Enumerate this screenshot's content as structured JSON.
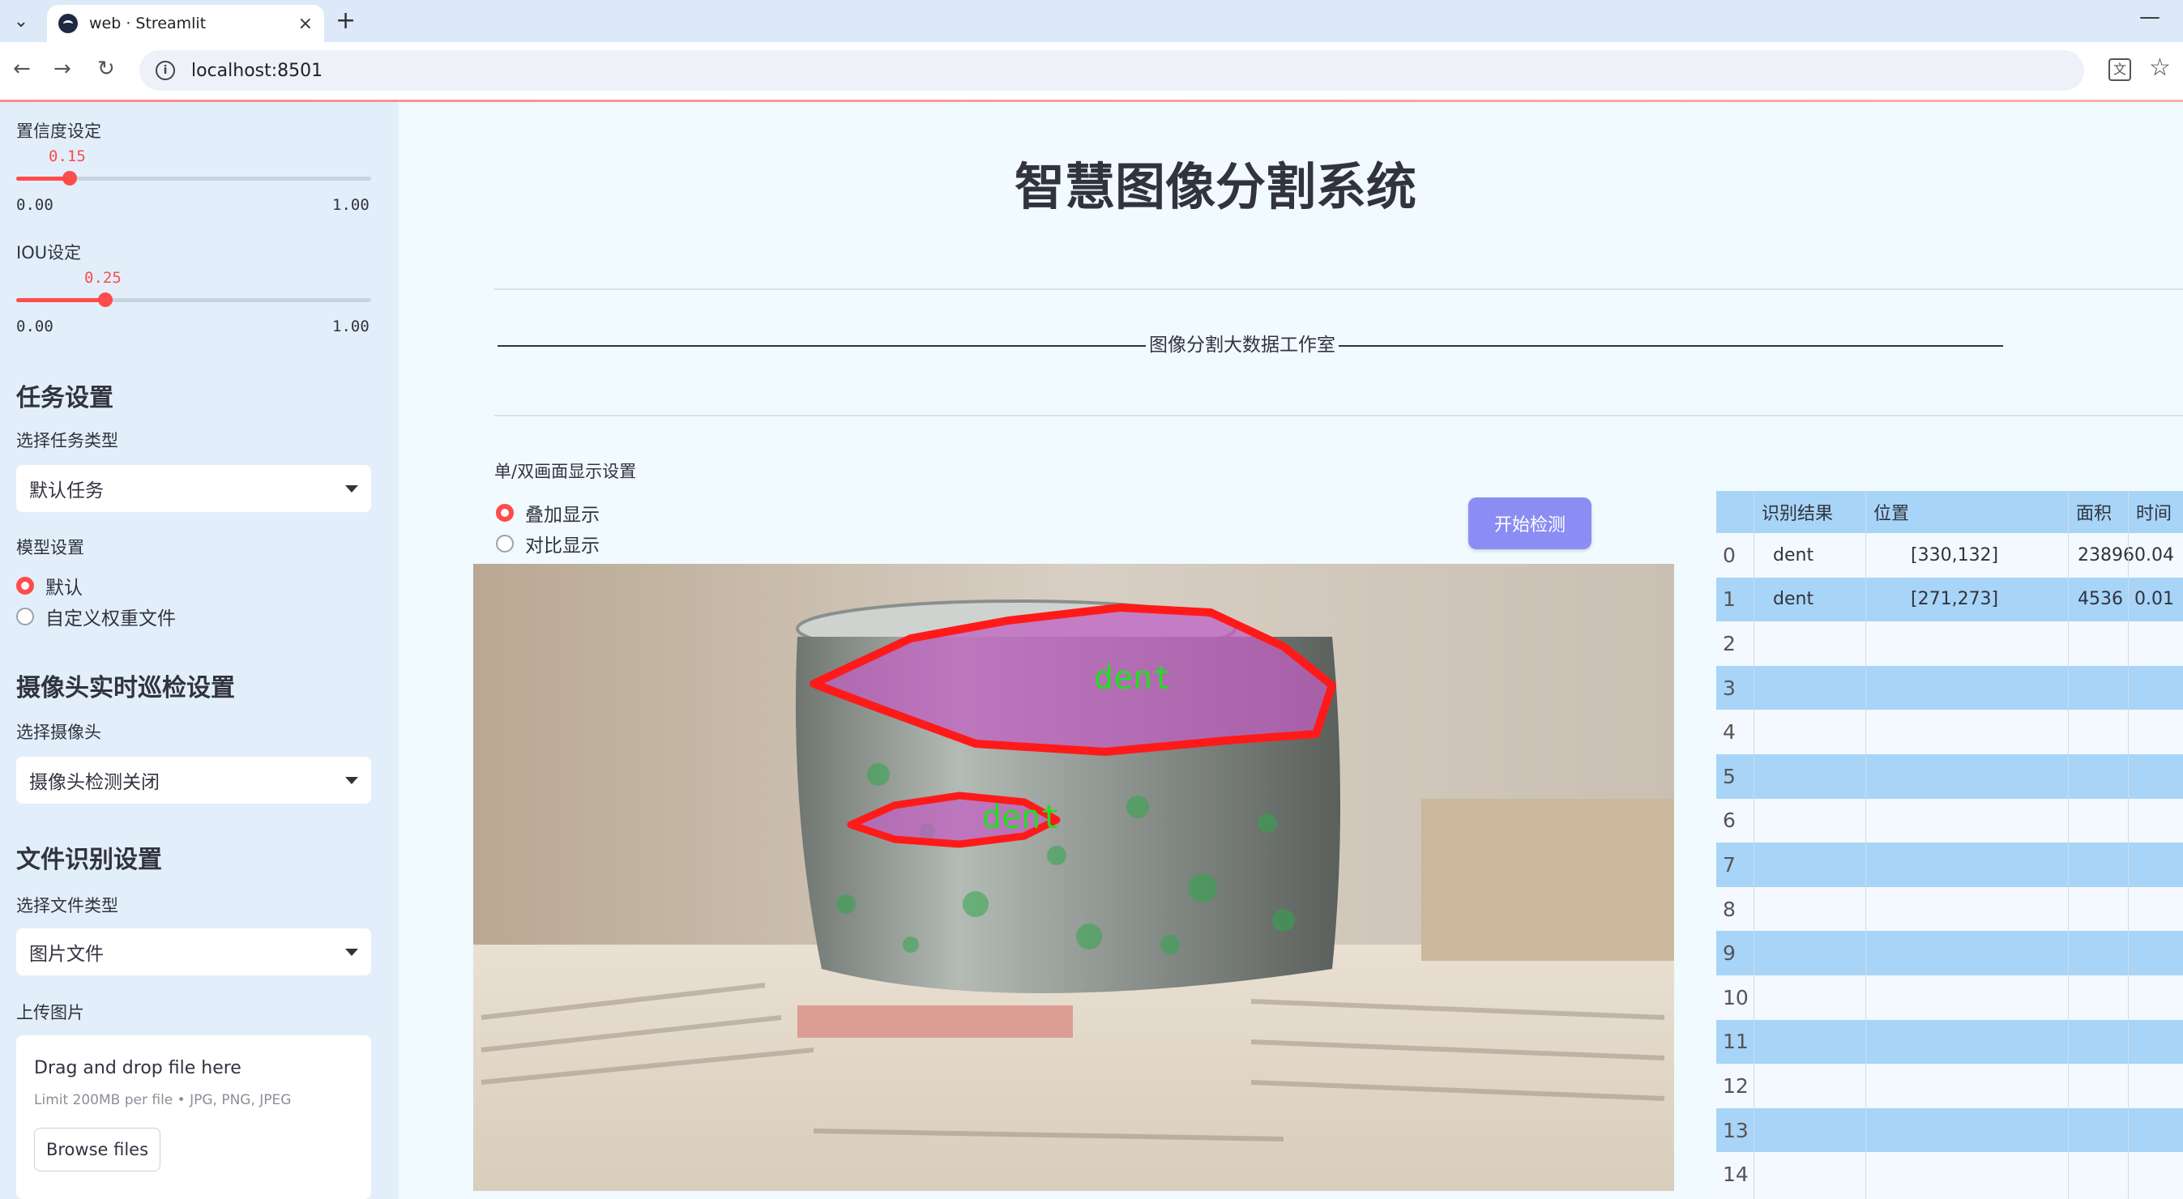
{
  "browser": {
    "tab_title": "web · Streamlit",
    "url": "localhost:8501"
  },
  "sidebar": {
    "confidence": {
      "label": "置信度设定",
      "value": "0.15",
      "min": "0.00",
      "max": "1.00",
      "fraction": 0.15
    },
    "iou": {
      "label": "IOU设定",
      "value": "0.25",
      "min": "0.00",
      "max": "1.00",
      "fraction": 0.25
    },
    "task": {
      "heading": "任务设置",
      "label": "选择任务类型",
      "selected": "默认任务"
    },
    "model": {
      "label": "模型设置",
      "options": [
        "默认",
        "自定义权重文件"
      ],
      "selected_index": 0
    },
    "camera": {
      "heading": "摄像头实时巡检设置",
      "label": "选择摄像头",
      "selected": "摄像头检测关闭"
    },
    "file": {
      "heading": "文件识别设置",
      "label": "选择文件类型",
      "selected": "图片文件"
    },
    "upload": {
      "label": "上传图片",
      "drop_text": "Drag and drop file here",
      "limit_text": "Limit 200MB per file • JPG, PNG, JPEG",
      "browse_label": "Browse files"
    }
  },
  "main": {
    "title": "智慧图像分割系统",
    "divider_text": "图像分割大数据工作室",
    "display_setting": {
      "label": "单/双画面显示设置",
      "options": [
        "叠加显示",
        "对比显示"
      ],
      "selected_index": 0
    },
    "start_button": "开始检测",
    "detections_overlay": [
      {
        "label": "dent"
      },
      {
        "label": "dent"
      }
    ]
  },
  "results_table": {
    "headers": [
      "识别结果",
      "位置",
      "面积",
      "时间"
    ],
    "rows": [
      {
        "index": "0",
        "result": "dent",
        "position": "[330,132]",
        "area": "23896",
        "time": "0.04"
      },
      {
        "index": "1",
        "result": "dent",
        "position": "[271,273]",
        "area": "4536",
        "time": "0.01"
      },
      {
        "index": "2",
        "result": "",
        "position": "",
        "area": "",
        "time": ""
      },
      {
        "index": "3",
        "result": "",
        "position": "",
        "area": "",
        "time": ""
      },
      {
        "index": "4",
        "result": "",
        "position": "",
        "area": "",
        "time": ""
      },
      {
        "index": "5",
        "result": "",
        "position": "",
        "area": "",
        "time": ""
      },
      {
        "index": "6",
        "result": "",
        "position": "",
        "area": "",
        "time": ""
      },
      {
        "index": "7",
        "result": "",
        "position": "",
        "area": "",
        "time": ""
      },
      {
        "index": "8",
        "result": "",
        "position": "",
        "area": "",
        "time": ""
      },
      {
        "index": "9",
        "result": "",
        "position": "",
        "area": "",
        "time": ""
      },
      {
        "index": "10",
        "result": "",
        "position": "",
        "area": "",
        "time": ""
      },
      {
        "index": "11",
        "result": "",
        "position": "",
        "area": "",
        "time": ""
      },
      {
        "index": "12",
        "result": "",
        "position": "",
        "area": "",
        "time": ""
      },
      {
        "index": "13",
        "result": "",
        "position": "",
        "area": "",
        "time": ""
      },
      {
        "index": "14",
        "result": "",
        "position": "",
        "area": "",
        "time": ""
      }
    ]
  },
  "colors": {
    "accent": "#ff4b4b",
    "button": "#8c8cf5",
    "sidebar_bg": "#e2effb",
    "table_stripe": "#a8d4f7",
    "mask_outline": "#ff1a1a",
    "mask_label": "#22dd22"
  }
}
